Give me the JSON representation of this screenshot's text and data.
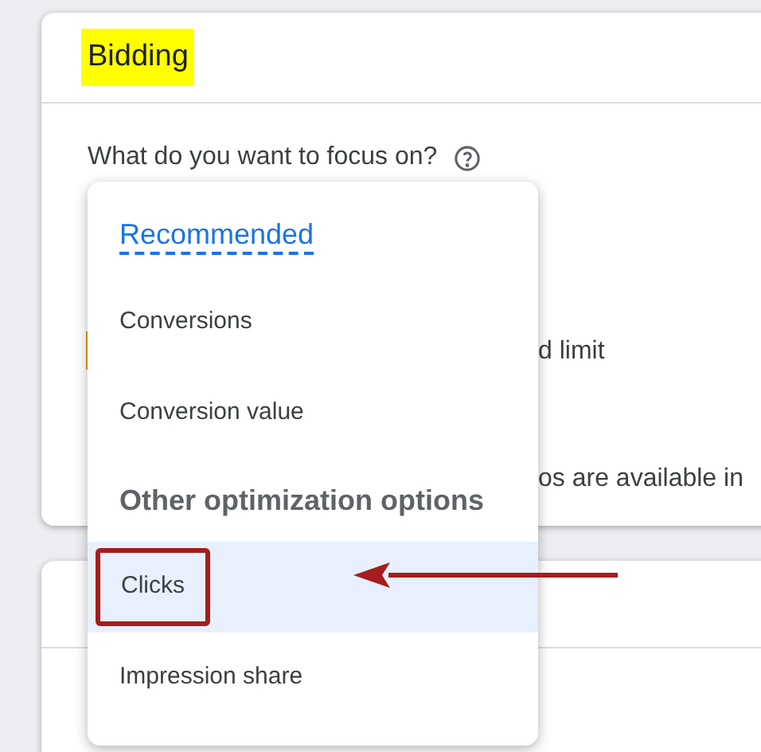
{
  "card": {
    "title": "Bidding",
    "question": "What do you want to focus on?",
    "partial_texts": [
      "d limit",
      "os are available in"
    ]
  },
  "menu": [
    {
      "kind": "heading",
      "label": "Recommended",
      "selected": false
    },
    {
      "kind": "option",
      "label": "Conversions",
      "selected": false,
      "annotated": false
    },
    {
      "kind": "option",
      "label": "Conversion value",
      "selected": false,
      "annotated": false
    },
    {
      "kind": "subheading",
      "label": "Other optimization options",
      "selected": false
    },
    {
      "kind": "option",
      "label": "Clicks",
      "selected": true,
      "annotated": true
    },
    {
      "kind": "option",
      "label": "Impression share",
      "selected": false,
      "annotated": false
    }
  ]
}
